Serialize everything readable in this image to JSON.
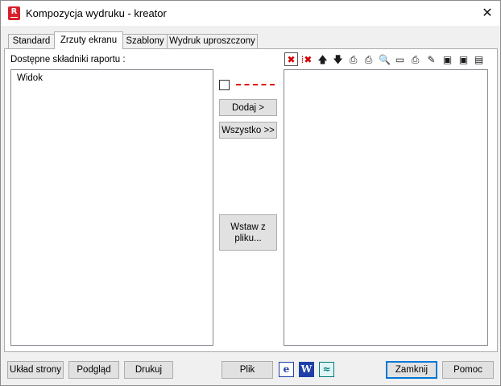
{
  "window": {
    "title": "Kompozycja wydruku - kreator",
    "app_icon_letter": "R"
  },
  "tabs": [
    {
      "label": "Standard"
    },
    {
      "label": "Zrzuty ekranu"
    },
    {
      "label": "Szablony"
    },
    {
      "label": "Wydruk uproszczony"
    }
  ],
  "left_panel": {
    "label": "Dostępne składniki raportu :",
    "items": [
      "Widok"
    ]
  },
  "middle": {
    "add_label": "Dodaj >",
    "all_label": "Wszystko >>",
    "insert_file_label": "Wstaw z\npliku...",
    "line_color": "#e00000"
  },
  "toolbar_icons": [
    "delete-icon",
    "delete-all-icon",
    "move-up-icon",
    "move-down-icon",
    "print-settings-icon",
    "print-settings-remove-icon",
    "print-preview-icon",
    "page-setup-icon",
    "printer-icon",
    "edit-page-icon",
    "save-template-icon",
    "save-template-as-icon",
    "table-icon"
  ],
  "bottom": {
    "page_layout_label": "Układ strony",
    "preview_label": "Podgląd",
    "print_label": "Drukuj",
    "file_label": "Plik",
    "close_label": "Zamknij",
    "help_label": "Pomoc"
  }
}
